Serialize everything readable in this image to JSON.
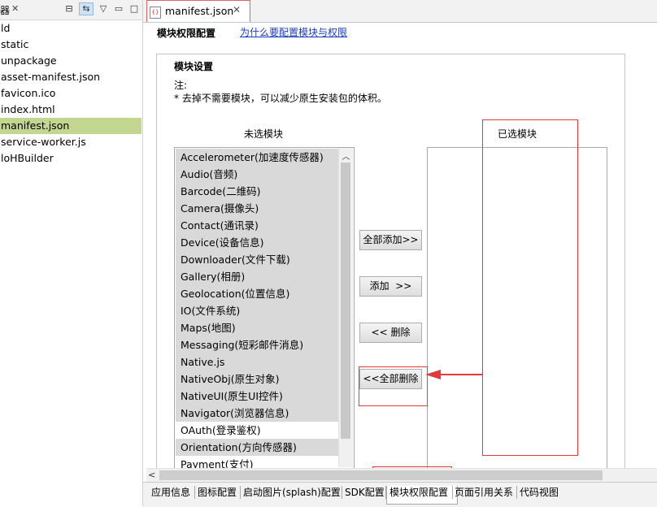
{
  "explorer": {
    "title": "器",
    "close_glyph": "✕",
    "toolbar_icons": [
      "collapse-all-icon",
      "link-with-editor-icon",
      "view-menu-icon",
      "minimize-icon",
      "maximize-icon"
    ],
    "items": [
      {
        "label": "ld",
        "selected": false
      },
      {
        "label": "static",
        "selected": false
      },
      {
        "label": "unpackage",
        "selected": false
      },
      {
        "label": "asset-manifest.json",
        "selected": false
      },
      {
        "label": "favicon.ico",
        "selected": false
      },
      {
        "label": "index.html",
        "selected": false
      },
      {
        "label": "manifest.json",
        "selected": true
      },
      {
        "label": "service-worker.js",
        "selected": false
      },
      {
        "label": "loHBuilder",
        "selected": false
      }
    ]
  },
  "editor_tab": {
    "label": "manifest.json",
    "close_glyph": "✕"
  },
  "page": {
    "heading": "模块权限配置",
    "help_link": "为什么要配置模块与权限"
  },
  "module_settings": {
    "title": "模块设置",
    "note_label": "注:",
    "note_text": "* 去掉不需要模块，可以减少原生安装包的体积。",
    "unselected_label": "未选模块",
    "selected_label": "已选模块",
    "unselected_modules": [
      {
        "label": "Accelerometer(加速度传感器)",
        "highlight": true
      },
      {
        "label": "Audio(音频)",
        "highlight": true
      },
      {
        "label": "Barcode(二维码)",
        "highlight": true
      },
      {
        "label": "Camera(摄像头)",
        "highlight": true
      },
      {
        "label": "Contact(通讯录)",
        "highlight": true
      },
      {
        "label": "Device(设备信息)",
        "highlight": true
      },
      {
        "label": "Downloader(文件下载)",
        "highlight": true
      },
      {
        "label": "Gallery(相册)",
        "highlight": true
      },
      {
        "label": "Geolocation(位置信息)",
        "highlight": true
      },
      {
        "label": "IO(文件系统)",
        "highlight": true
      },
      {
        "label": "Maps(地图)",
        "highlight": true
      },
      {
        "label": "Messaging(短彩邮件消息)",
        "highlight": true
      },
      {
        "label": "Native.js",
        "highlight": true
      },
      {
        "label": "NativeObj(原生对象)",
        "highlight": true
      },
      {
        "label": "NativeUI(原生UI控件)",
        "highlight": true
      },
      {
        "label": "Navigator(浏览器信息)",
        "highlight": true
      },
      {
        "label": "OAuth(登录鉴权)",
        "highlight": false
      },
      {
        "label": "Orientation(方向传感器)",
        "highlight": true
      },
      {
        "label": "Payment(支付)",
        "highlight": false
      }
    ],
    "selected_modules": [],
    "buttons": {
      "add_all": "全部添加>>",
      "add": "添加  >>",
      "remove": "<< 删除",
      "remove_all": "<<全部删除"
    }
  },
  "bottom_tabs": [
    {
      "label": "应用信息",
      "active": false
    },
    {
      "label": "图标配置",
      "active": false
    },
    {
      "label": "启动图片(splash)配置",
      "active": false
    },
    {
      "label": "SDK配置",
      "active": false
    },
    {
      "label": "模块权限配置",
      "active": true
    },
    {
      "label": "页面引用关系",
      "active": false
    },
    {
      "label": "代码视图",
      "active": false
    }
  ],
  "annotation_color": "#e03a3a",
  "selection_color": "#c3d68f"
}
